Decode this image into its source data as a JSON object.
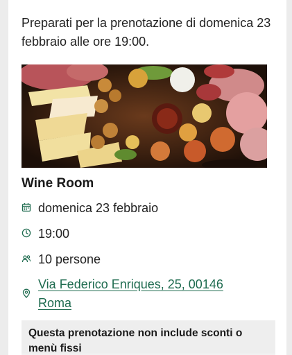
{
  "intro_text": "Preparati per la prenotazione di domenica 23 febbraio alle ore 19:00.",
  "venue": {
    "name": "Wine Room"
  },
  "details": {
    "date": "domenica 23 febbraio",
    "time": "19:00",
    "people": "10 persone",
    "address": "Via Federico Enriques, 25, 00146 Roma"
  },
  "icons": {
    "date": "calendar-icon",
    "time": "clock-icon",
    "people": "people-icon",
    "address": "location-pin-icon"
  },
  "notice": "Questa prenotazione non include sconti o menù fissi",
  "colors": {
    "accent_green": "#1e6b4f",
    "notice_bg": "#eeeeee"
  }
}
